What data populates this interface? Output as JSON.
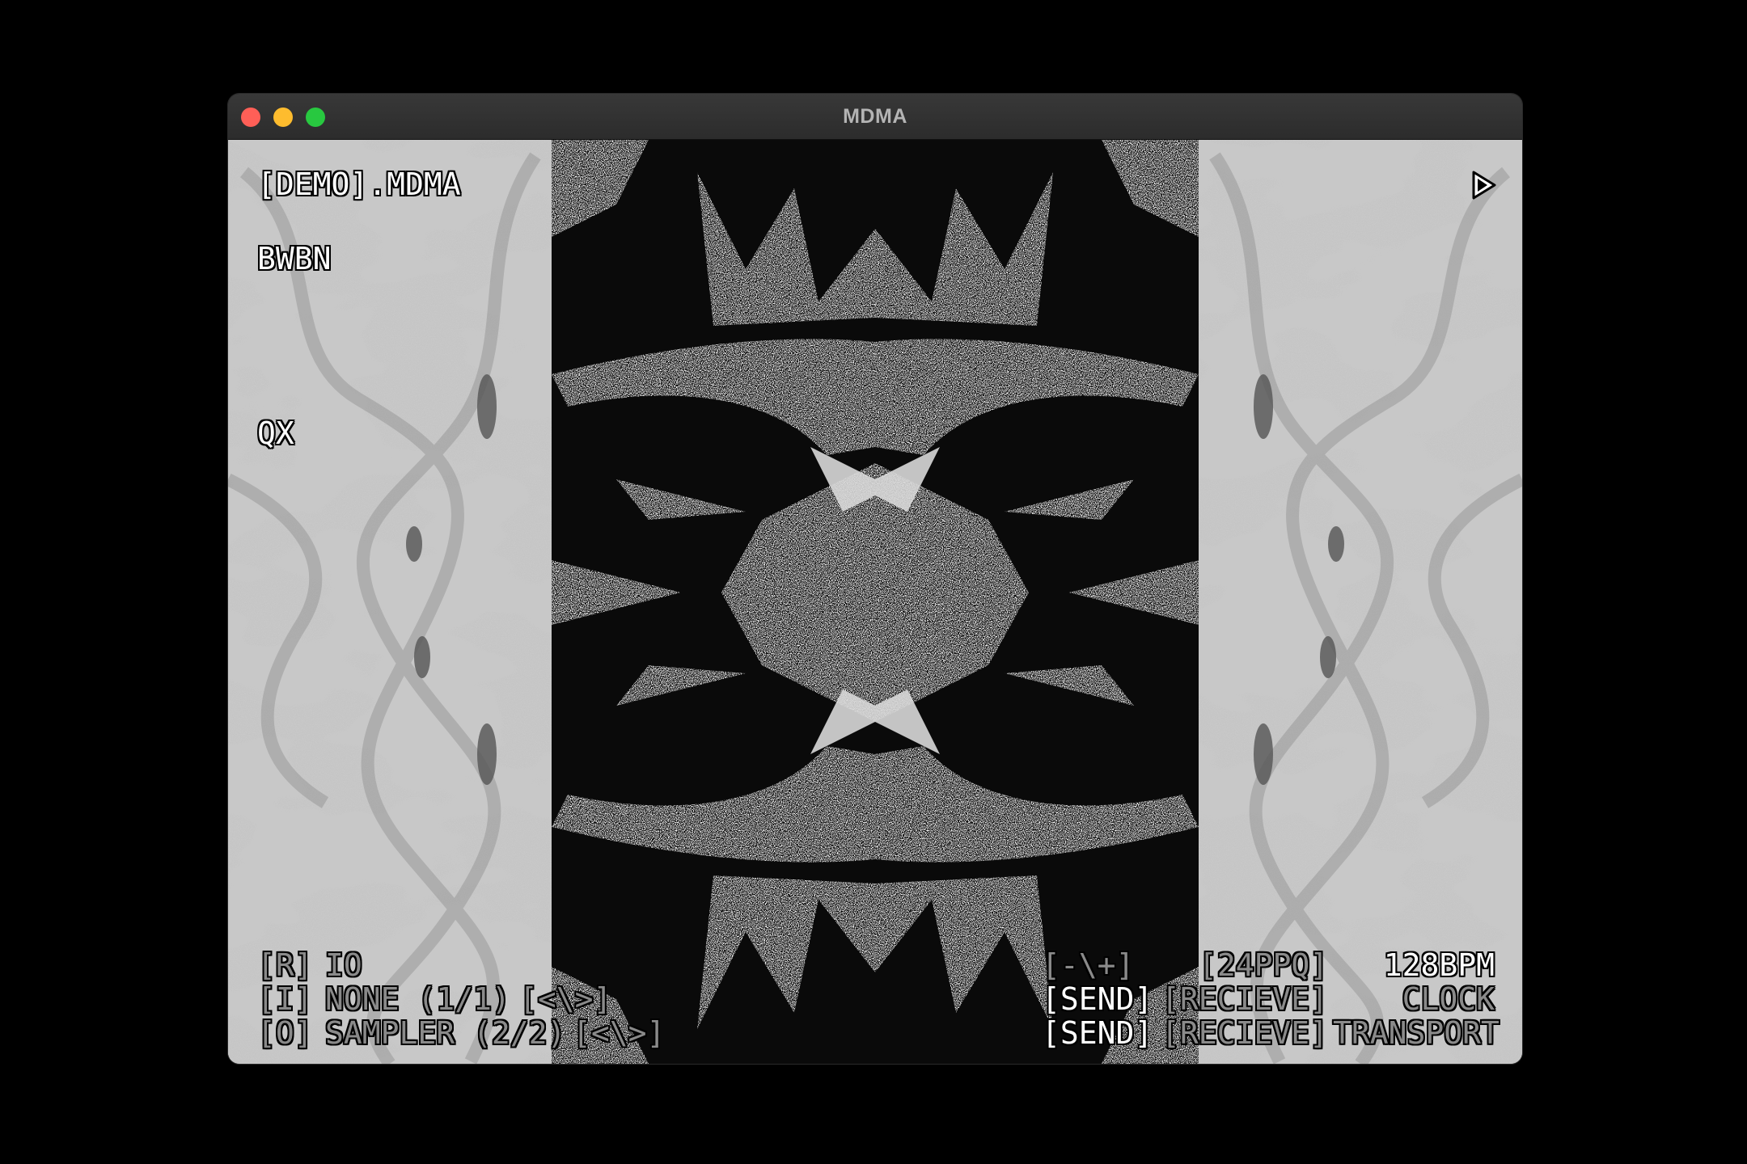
{
  "window": {
    "title": "MDMA"
  },
  "header": {
    "file_name": "[DEMO].MDMA",
    "play_icon": "play-icon"
  },
  "labels": {
    "top": "BWBN",
    "middle": "QX"
  },
  "io_panel": {
    "row_r": {
      "key": "[R]",
      "value": "IO"
    },
    "row_i": {
      "key": "[I]",
      "value": "NONE (1/1)",
      "nav": "[<\\>]"
    },
    "row_o": {
      "key": "[O]",
      "value": "SAMPLER (2/2)",
      "nav": "[<\\>]"
    }
  },
  "transport_panel": {
    "zoom": "[-\\+]",
    "ppq": "[24PPQ]",
    "bpm": "128BPM",
    "clock_send": "[SEND]",
    "clock_receive": "[RECIEVE]",
    "clock_label": "CLOCK",
    "transport_send": "[SEND]",
    "transport_receive": "[RECIEVE]",
    "transport_label": "TRANSPORT"
  },
  "colors": {
    "side_bg": "#c8c8c8",
    "side_pattern": "#8f8f8f",
    "center_bg": "#0a0a0a",
    "center_pattern": "#e6e6e6"
  }
}
